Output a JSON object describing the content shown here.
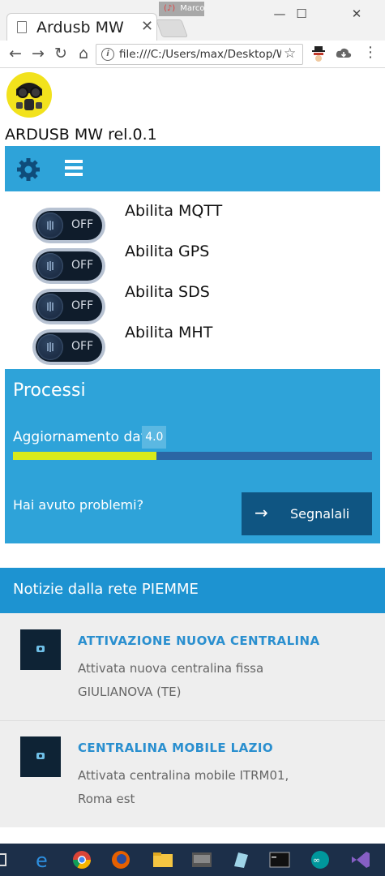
{
  "browser": {
    "tab_title": "Ardusb MW",
    "profile_name": "Marco",
    "url": "file:///C:/Users/max/Desktop/W",
    "win_min": "—",
    "win_max": "☐",
    "win_close": "✕",
    "tab_close": "✕"
  },
  "app": {
    "title": "ARDUSB MW rel.0.1"
  },
  "toggles": [
    {
      "state": "OFF",
      "label": "Abilita MQTT"
    },
    {
      "state": "OFF",
      "label": "Abilita GPS"
    },
    {
      "state": "OFF",
      "label": "Abilita SDS"
    },
    {
      "state": "OFF",
      "label": "Abilita MHT"
    }
  ],
  "processi": {
    "heading": "Processi",
    "progress_label": "Aggiornamento dat",
    "progress_value": "4.0",
    "progress_fraction": 0.4,
    "question": "Hai avuto problemi?",
    "report_button": "Segnalali"
  },
  "news": {
    "heading": "Notizie dalla rete PIEMME",
    "items": [
      {
        "title": "ATTIVAZIONE NUOVA CENTRALINA",
        "desc": "Attivata nuova centralina fissa GIULIANOVA (TE)"
      },
      {
        "title": "CENTRALINA MOBILE LAZIO",
        "desc": "Attivata centralina mobile ITRM01, Roma est"
      }
    ]
  },
  "colors": {
    "primary": "#2ea3d9",
    "news_header": "#1d93d1",
    "button_dark": "#0f5582",
    "progress_fill": "#d8ea1b",
    "taskbar": "#1c2f49"
  }
}
